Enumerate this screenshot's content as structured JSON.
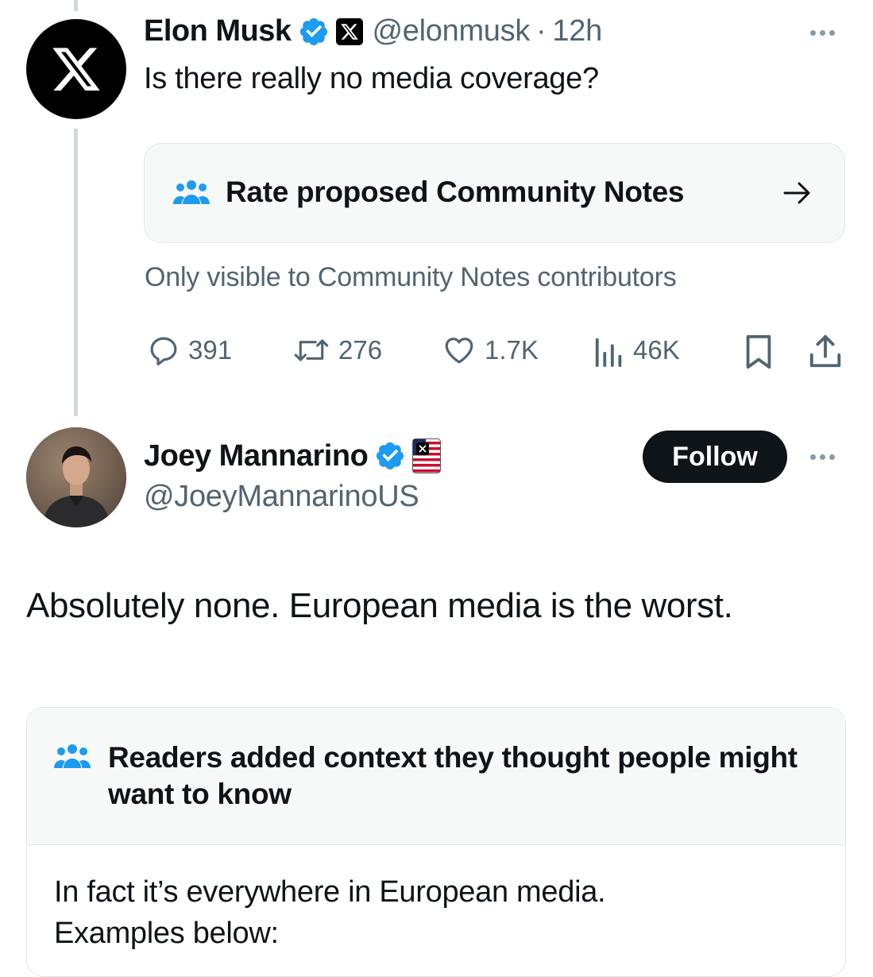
{
  "tweet1": {
    "author_name": "Elon Musk",
    "verified_icon": "verified-badge-icon",
    "affiliation_icon": "x-logo-icon",
    "handle": "@elonmusk",
    "separator": "·",
    "time": "12h",
    "text": "Is there really no media coverage?",
    "avatar_icon": "x-logo-icon",
    "notes_prompt": {
      "icon": "community-notes-people-icon",
      "label": "Rate proposed Community Notes",
      "arrow_icon": "arrow-right-icon"
    },
    "notes_visibility": "Only visible to Community Notes contributors",
    "stats": {
      "replies": "391",
      "reposts": "276",
      "likes": "1.7K",
      "views": "46K"
    }
  },
  "tweet2": {
    "author_name": "Joey Mannarino",
    "verified_icon": "verified-badge-icon",
    "affiliation_icon": "flag-badge-icon",
    "handle": "@JoeyMannarinoUS",
    "follow_label": "Follow",
    "text": "Absolutely none. European media is the worst.",
    "community_note": {
      "icon": "community-notes-people-icon",
      "title": "Readers added context they thought people might want to know",
      "body_line1": "In fact it’s everywhere in European media.",
      "body_line2": "Examples below:"
    }
  },
  "colors": {
    "accent_blue": "#1d9bf0",
    "text_primary": "#0f1419",
    "text_secondary": "#536471",
    "border": "#e1e8ed",
    "note_bg": "#f7f9f9"
  }
}
